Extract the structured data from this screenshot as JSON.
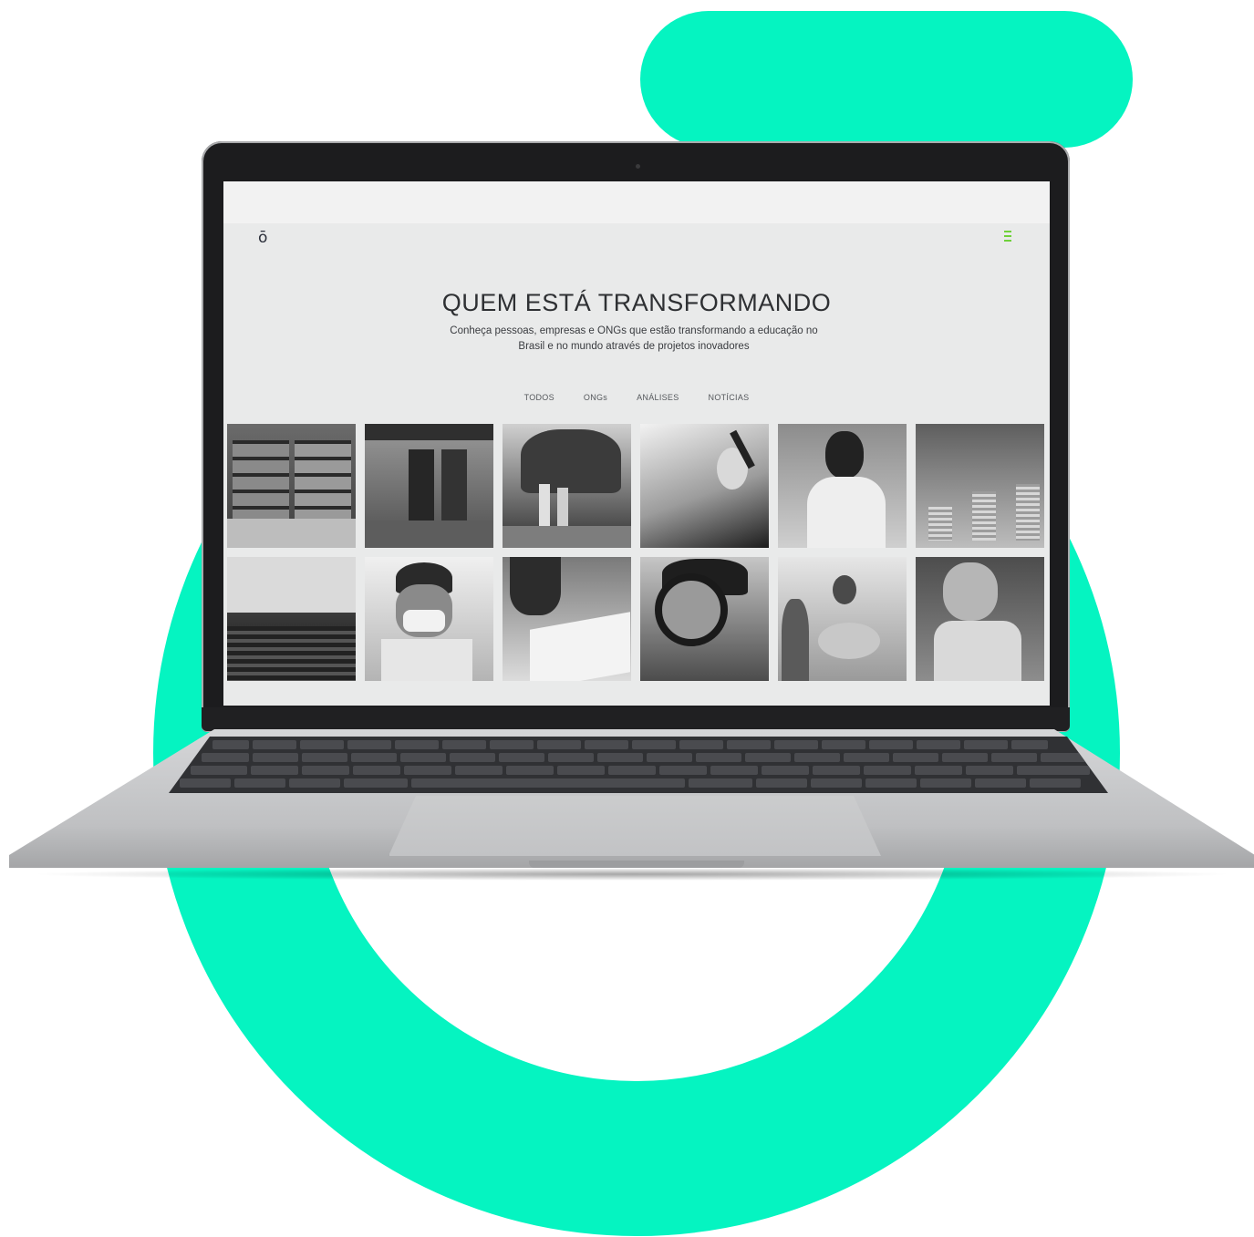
{
  "brand": {
    "logo_glyph": "ō",
    "accent_color": "#05f4c1",
    "menu_color": "#6fd13a"
  },
  "header": {
    "title": "QUEM ESTÁ TRANSFORMANDO"
  },
  "hero": {
    "subtitle_line1": "Conheça pessoas, empresas e ONGs que estão transformando a educação no",
    "subtitle_line2": "Brasil e no mundo através de projetos inovadores"
  },
  "filters": [
    "TODOS",
    "ONGs",
    "ANÁLISES",
    "NOTÍCIAS"
  ],
  "gallery": {
    "items": [
      "library-photo",
      "building-photo",
      "people-walking-photo",
      "writing-hand-photo",
      "smiling-man-photo",
      "coins-photo",
      "auditorium-photo",
      "student-mask-photo",
      "student-writing-photo",
      "magnifier-boy-photo",
      "group-signs-photo",
      "smiling-boy-photo"
    ]
  },
  "icons": {
    "menu": "hamburger-icon",
    "logo": "logo-icon"
  }
}
